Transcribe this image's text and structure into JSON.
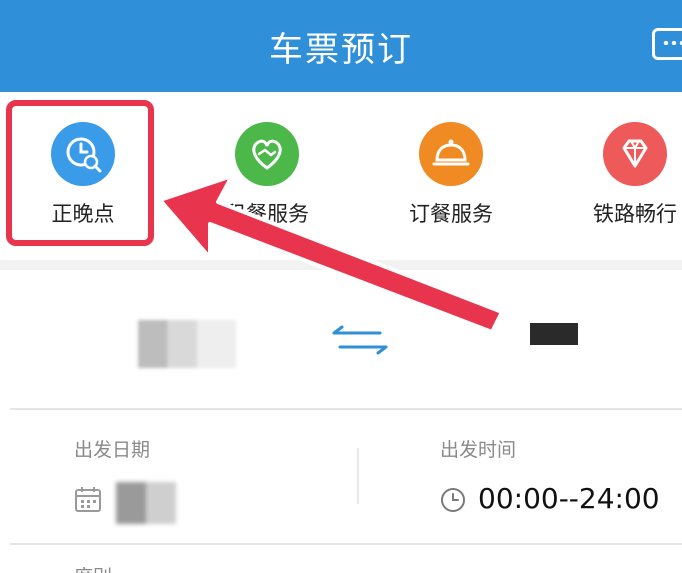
{
  "header": {
    "title": "车票预订",
    "color": "#2f8fd8"
  },
  "services": [
    {
      "label": "正晚点",
      "icon": "clock-search-icon",
      "color": "#3a9be8"
    },
    {
      "label": "租餐服务",
      "icon": "handshake-heart-icon",
      "color": "#4cb84a"
    },
    {
      "label": "订餐服务",
      "icon": "service-bell-icon",
      "color": "#f08a22"
    },
    {
      "label": "铁路畅行",
      "icon": "diamond-icon",
      "color": "#ee5a5a"
    }
  ],
  "annotation": {
    "highlight_color": "#e8344c"
  },
  "booking": {
    "date_label": "出发日期",
    "time_label": "出发时间",
    "time_value": "00:00--24:00",
    "bottom_label": "席别"
  }
}
